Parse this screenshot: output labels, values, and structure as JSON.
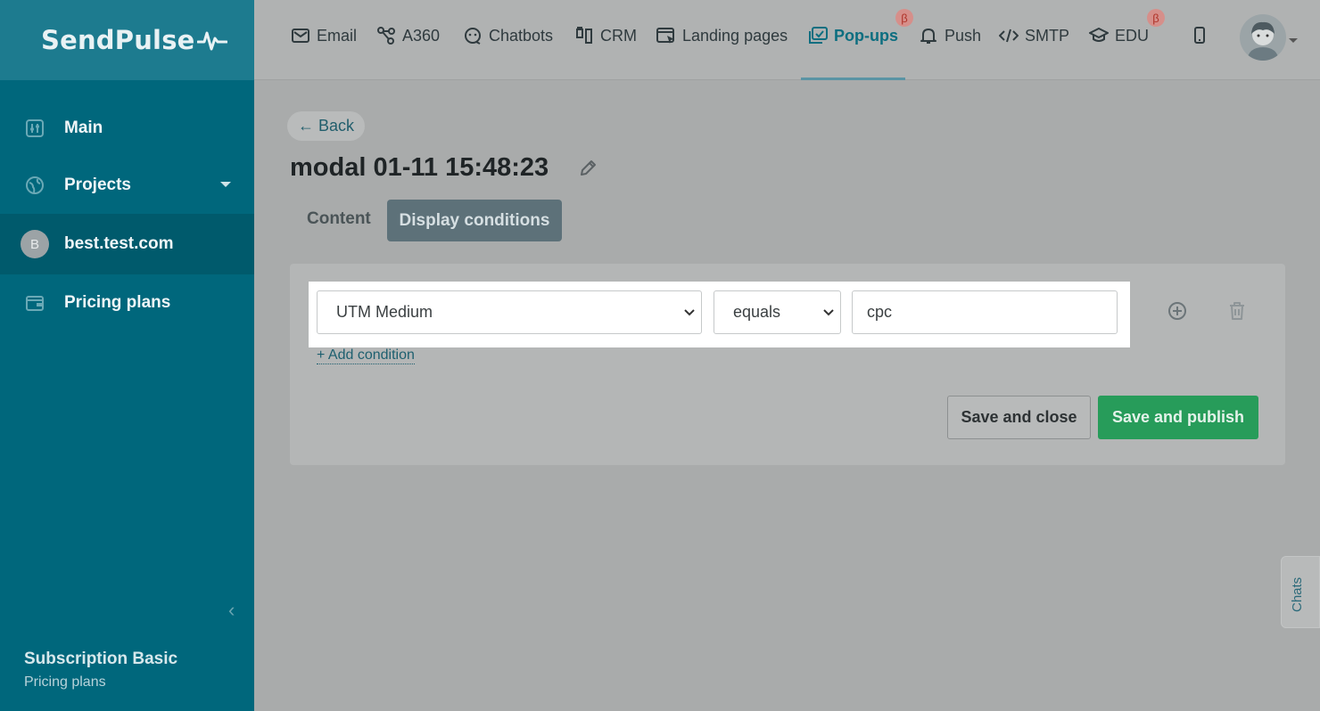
{
  "brand": {
    "logo": "SendPulse"
  },
  "sidebar": {
    "items": [
      {
        "label": "Main",
        "icon": "dashboard-icon"
      },
      {
        "label": "Projects",
        "icon": "globe-icon"
      },
      {
        "label": "best.test.com",
        "avatar_letter": "B"
      },
      {
        "label": "Pricing plans",
        "icon": "wallet-icon"
      }
    ],
    "plan": {
      "title": "Subscription Basic",
      "link": "Pricing plans"
    }
  },
  "topnav": {
    "tabs": [
      {
        "label": "Email",
        "icon": "envelope-icon"
      },
      {
        "label": "A360",
        "icon": "flow-icon"
      },
      {
        "label": "Chatbots",
        "icon": "chat-icon"
      },
      {
        "label": "CRM",
        "icon": "kanban-icon"
      },
      {
        "label": "Landing pages",
        "icon": "landing-icon"
      },
      {
        "label": "Pop-ups",
        "icon": "popup-icon",
        "active": true,
        "beta": "β"
      },
      {
        "label": "Push",
        "icon": "bell-icon"
      },
      {
        "label": "SMTP",
        "icon": "code-icon"
      },
      {
        "label": "EDU",
        "icon": "graduation-icon",
        "beta": "β"
      }
    ]
  },
  "page": {
    "back_label": "← Back",
    "title": "modal 01-11 15:48:23",
    "tabs": {
      "content": "Content",
      "display": "Display conditions"
    }
  },
  "condition": {
    "field": "UTM Medium",
    "operator": "equals",
    "value": "cpc",
    "add_label": "+ Add condition"
  },
  "actions": {
    "save_close": "Save and close",
    "save_publish": "Save and publish"
  },
  "chats_label": "Chats",
  "colors": {
    "sidebar": "#00677c",
    "accent": "#0c6e80",
    "publish": "#279c5a"
  }
}
